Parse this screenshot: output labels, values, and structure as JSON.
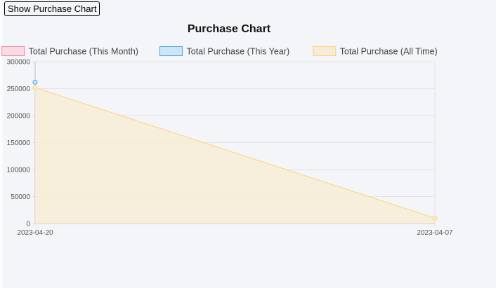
{
  "toolbar": {
    "show_chart_label": "Show Purchase Chart"
  },
  "colors": {
    "month": {
      "fill": "#fadbe3",
      "stroke": "#f08aa3"
    },
    "year": {
      "fill": "#cfe5f5",
      "stroke": "#4aa8e0"
    },
    "all": {
      "fill": "#f7edd7",
      "stroke": "#fbd37a"
    },
    "grid": "#e4e4e4",
    "axis": "#bdbdbd",
    "tick_text": "#555555",
    "title_text": "#111111",
    "legend_text": "#444444"
  },
  "chart_data": {
    "type": "area",
    "title": "Purchase Chart",
    "categories": [
      "2023-04-20",
      "2023-04-07"
    ],
    "ylim": [
      0,
      300000
    ],
    "yticks": [
      0,
      50000,
      100000,
      150000,
      200000,
      250000,
      300000
    ],
    "legend_position": "top",
    "grid": true,
    "series": [
      {
        "name": "Total Purchase (This Month)",
        "key": "month",
        "values": [
          null,
          null
        ]
      },
      {
        "name": "Total Purchase (This Year)",
        "key": "year",
        "values": [
          262000,
          null
        ]
      },
      {
        "name": "Total Purchase (All Time)",
        "key": "all",
        "values": [
          252000,
          10000
        ]
      }
    ]
  }
}
